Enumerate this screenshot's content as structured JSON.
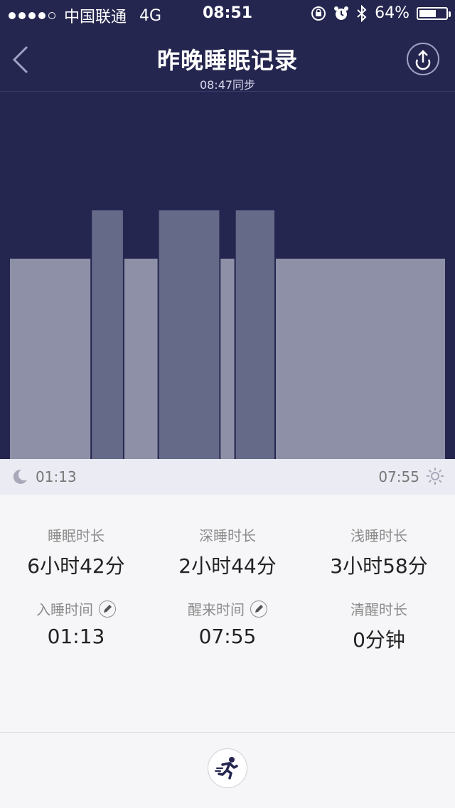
{
  "status_bar": {
    "carrier": "中国联通",
    "network": "4G",
    "time": "08:51",
    "battery_percent_text": "64%",
    "battery_level": 0.64
  },
  "header": {
    "title": "昨晚睡眠记录",
    "subtitle": "08:47同步"
  },
  "chart_data": {
    "type": "bar",
    "title": "",
    "xlabel": "",
    "ylabel": "",
    "categories": [
      "light",
      "deep",
      "light",
      "deep",
      "light",
      "deep",
      "light"
    ],
    "segments": [
      {
        "stage": "light",
        "start": "01:13",
        "end": "02:28"
      },
      {
        "stage": "deep",
        "start": "02:28",
        "end": "02:58"
      },
      {
        "stage": "light",
        "start": "02:58",
        "end": "03:30"
      },
      {
        "stage": "deep",
        "start": "03:30",
        "end": "04:27"
      },
      {
        "stage": "light",
        "start": "04:27",
        "end": "04:41"
      },
      {
        "stage": "deep",
        "start": "04:41",
        "end": "05:18"
      },
      {
        "stage": "light",
        "start": "05:18",
        "end": "07:55"
      }
    ],
    "levels": {
      "light": 1,
      "deep": 2
    },
    "x_start": "01:13",
    "x_end": "07:55",
    "colors": {
      "light": "#8e90a7",
      "deep": "#666a89",
      "background": "#25264f"
    }
  },
  "time_axis": {
    "start": "01:13",
    "end": "07:55"
  },
  "stats": {
    "total": {
      "label": "睡眠时长",
      "value": "6小时42分"
    },
    "deep": {
      "label": "深睡时长",
      "value": "2小时44分"
    },
    "light": {
      "label": "浅睡时长",
      "value": "3小时58分"
    },
    "sleep_time": {
      "label": "入睡时间",
      "value": "01:13"
    },
    "wake_time": {
      "label": "醒来时间",
      "value": "07:55"
    },
    "awake": {
      "label": "清醒时长",
      "value": "0分钟"
    }
  },
  "icons": {
    "back": "chevron-left-icon",
    "share": "share-upload-icon",
    "moon": "moon-icon",
    "sun": "sun-icon",
    "edit": "pencil-icon",
    "run": "running-icon"
  }
}
